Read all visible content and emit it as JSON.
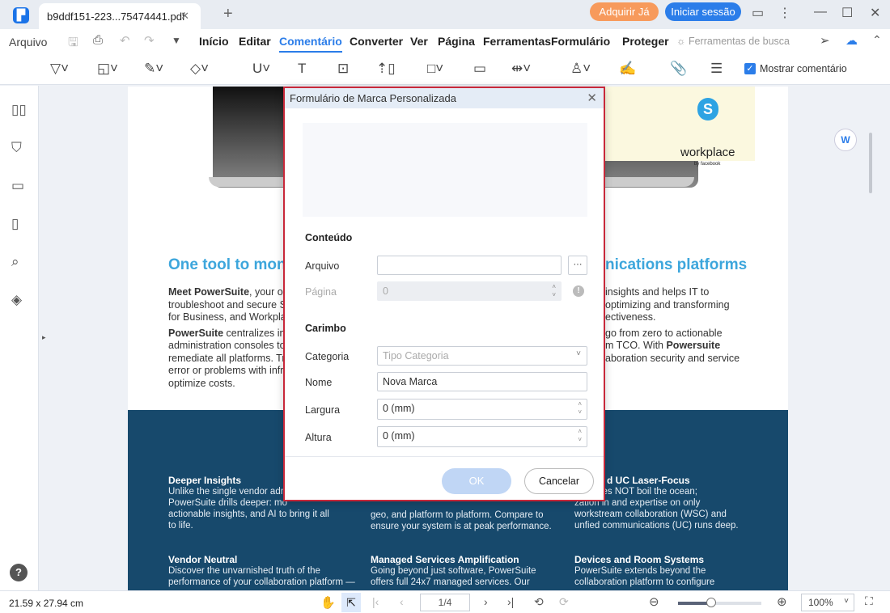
{
  "app": {
    "tab_title": "b9ddf151-223...75474441.pdf",
    "buy_label": "Adquirir Já",
    "login_label": "Iniciar sessão"
  },
  "menu": {
    "file": "Arquivo",
    "items": [
      "Início",
      "Editar",
      "Comentário",
      "Converter",
      "Ver",
      "Página",
      "Ferramentas",
      "Formulário",
      "Proteger"
    ],
    "active": "Comentário",
    "search_tools": "Ferramentas de busca"
  },
  "toolbar": {
    "show_comment": "Mostrar comentário",
    "show_comment_checked": true
  },
  "doc": {
    "heading_left": "One tool to moni",
    "heading_right": "nications platforms",
    "left_p1_bold": "Meet PowerSuite",
    "left_p1": ", your one",
    "left_p1b": "troubleshoot and secure Sk",
    "left_p1c": "for Business, and Workplac",
    "left_p2_bold": "PowerSuite",
    "left_p2": " centralizes info",
    "left_p2b": "administration consoles to",
    "left_p2c": "remediate all platforms. Tr",
    "left_p2d": "error or problems with infra",
    "left_p2e": "optimize costs.",
    "right_l1": "insights and helps IT to",
    "right_l2": "optimizing and transforming",
    "right_l3": "ectiveness.",
    "right_l4": "go from zero to actionable",
    "right_l5a": "m TCO. With ",
    "right_l5b": "Powersuite",
    "right_l6": "aboration security and  service",
    "logo_workplace": "workplace",
    "logo_facebook": "by facebook",
    "f1_title": "Deeper Insights",
    "f1_text": "Unlike the single vendor adm\nPowerSuite drills deeper: mo\nactionable insights, and AI to bring it all\nto life.",
    "f2_text": "geo, and platform to platform. Compare to\nensure your system is at peak performance.",
    "f3_title": "d UC Laser-Focus",
    "f3_text": "uite does NOT boil the ocean;\nzation in and expertise on only\nworkstream collaboration (WSC) and\nunfied communications (UC) runs deep.",
    "f4_title": "Vendor Neutral",
    "f4_text": "Discover the unvarnished truth of the\nperformance of your collaboration platform —",
    "f5_title": "Managed Services Amplification",
    "f5_text": "Going beyond just software, PowerSuite\noffers full 24x7 managed services. Our",
    "f6_title": "Devices and Room Systems",
    "f6_text": "PowerSuite extends beyond the\ncollaboration platform to configure"
  },
  "dialog": {
    "title": "Formulário de Marca Personalizada",
    "content_section": "Conteúdo",
    "file_label": "Arquivo",
    "file_value": "",
    "browse_label": "···",
    "page_label": "Página",
    "page_value": "0",
    "stamp_section": "Carimbo",
    "category_label": "Categoria",
    "category_placeholder": "Tipo Categoria",
    "name_label": "Nome",
    "name_value": "Nova Marca",
    "width_label": "Largura",
    "width_value": "0 (mm)",
    "height_label": "Altura",
    "height_value": "0 (mm)",
    "ok_label": "OK",
    "cancel_label": "Cancelar"
  },
  "status": {
    "page_size": "21.59 x 27.94 cm",
    "page_indicator": "1/4",
    "zoom": "100%",
    "zoom_level": 0.5
  }
}
